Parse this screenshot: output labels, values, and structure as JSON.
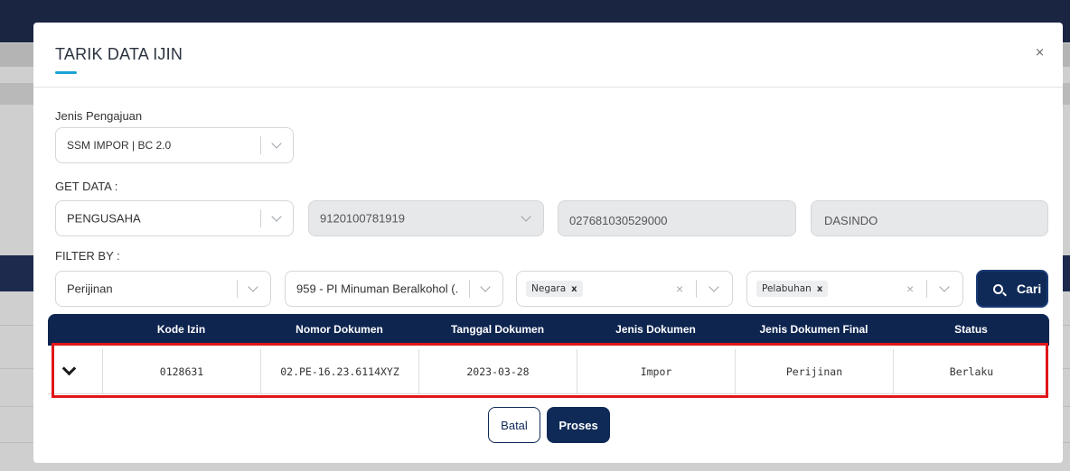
{
  "modal": {
    "title": "TARIK DATA IJIN",
    "close_label": "×"
  },
  "jenis_pengajuan": {
    "label": "Jenis Pengajuan",
    "value": "SSM IMPOR | BC 2.0"
  },
  "get_data": {
    "label": "GET DATA :",
    "pengusaha_value": "PENGUSAHA",
    "id_value": "9120100781919",
    "npwp_value": "027681030529000",
    "nama_value": "DASINDO"
  },
  "filter": {
    "label": "FILTER BY :",
    "kategori_value": "Perijinan",
    "izin_value": "959 - PI Minuman Beralkohol (...",
    "negara_tag": "Negara",
    "pelabuhan_tag": "Pelabuhan",
    "tag_remove": "x",
    "clear": "×",
    "search_button": "Cari"
  },
  "table": {
    "headers": [
      "Kode Izin",
      "Nomor Dokumen",
      "Tanggal Dokumen",
      "Jenis Dokumen",
      "Jenis Dokumen Final",
      "Status"
    ],
    "rows": [
      {
        "kode_izin": "0128631",
        "nomor_dokumen": "02.PE-16.23.6114XYZ",
        "tanggal_dokumen": "2023-03-28",
        "jenis_dokumen": "Impor",
        "jenis_dokumen_final": "Perijinan",
        "status": "Berlaku"
      }
    ]
  },
  "footer": {
    "cancel_label": "Batal",
    "process_label": "Proses"
  },
  "colors": {
    "primary": "#0f2a57",
    "accent": "#1aa3d3",
    "highlight": "#e0161a"
  }
}
